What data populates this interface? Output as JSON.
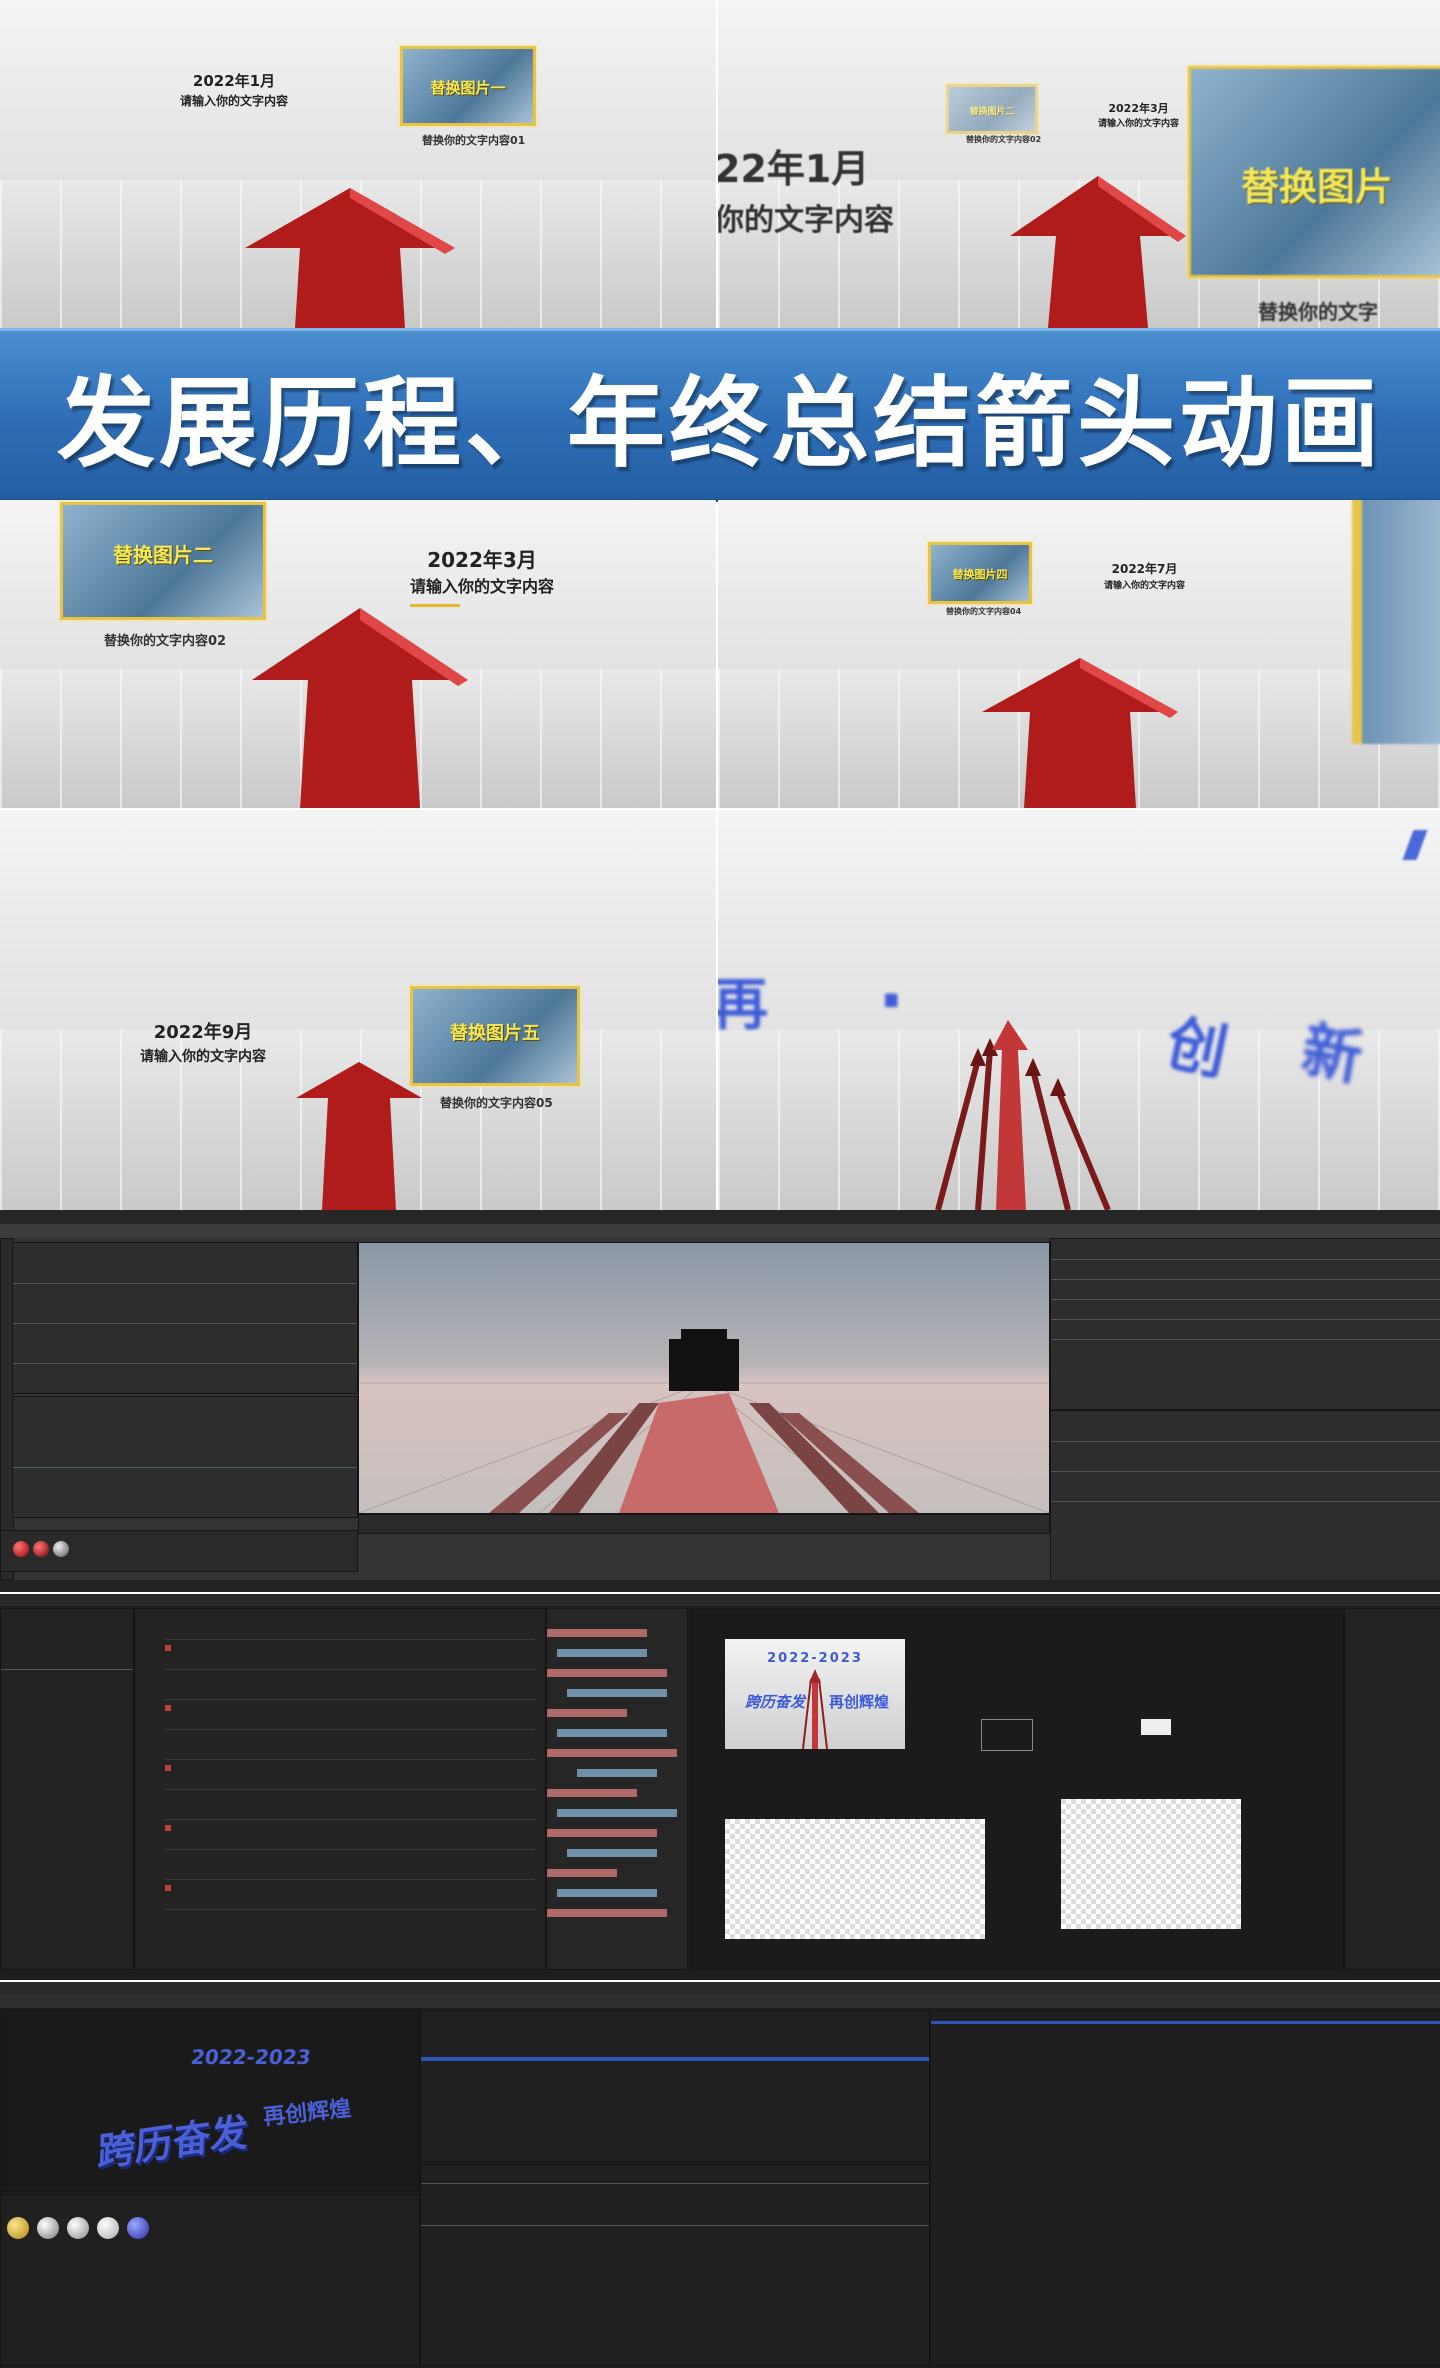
{
  "banner": {
    "title": "发展历程、年终总结箭头动画"
  },
  "panels": {
    "p1": {
      "date": "2022年1月",
      "text": "请输入你的文字内容",
      "photo_label": "替换图片一",
      "caption": "替换你的文字内容01"
    },
    "p2": {
      "date_big": "22年1月",
      "text_big": "你的文字内容",
      "date": "2022年3月",
      "text": "请输入你的文字内容",
      "photo_label_small": "替换图片二",
      "caption_small": "替换你的文字内容02",
      "photo_label": "替换图片",
      "caption": "替换你的文字"
    },
    "p3": {
      "date": "2022年3月",
      "text": "请输入你的文字内容",
      "photo_label": "替换图片二",
      "caption": "替换你的文字内容02"
    },
    "p4": {
      "date": "2022年7月",
      "text": "请输入你的文字内容",
      "photo_label": "替换图片四",
      "caption": "替换你的文字内容04"
    },
    "p5": {
      "date": "2022年9月",
      "text": "请输入你的文字内容",
      "photo_label": "替换图片五",
      "caption": "替换你的文字内容05"
    },
    "p6": {
      "glyphs": [
        "再",
        "·",
        "创",
        "新"
      ]
    }
  },
  "screens": {
    "ae": {
      "title_text": "2022-2023",
      "left_text": "跨历奋发",
      "right_text": "再创辉煌"
    },
    "c4d": {
      "title_text": "2022-2023",
      "main_text": "跨历奋发",
      "side_text": "再创辉煌"
    }
  },
  "colors": {
    "banner": "#2f6fb8",
    "arrow": "#b01c1c",
    "photo_border": "#e8c446"
  }
}
